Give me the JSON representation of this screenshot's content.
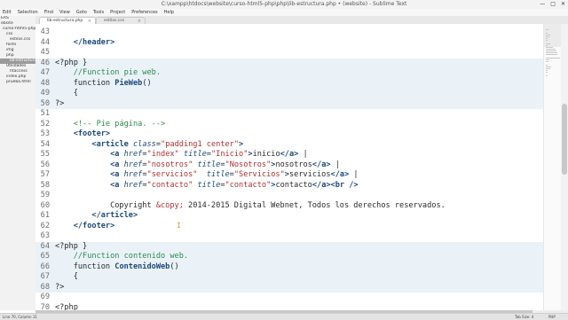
{
  "window": {
    "title": "C:\\xampp\\htdocs\\website\\curso-html5-php\\php\\lib-estructura.php • (website) - Sublime Text",
    "controls": [
      "—",
      "□",
      "✕"
    ]
  },
  "menu": [
    "Edit",
    "Selection",
    "Find",
    "View",
    "Goto",
    "Tools",
    "Project",
    "Preferences",
    "Help"
  ],
  "sidebar": {
    "items": [
      {
        "label": "ERS",
        "indent": 0
      },
      {
        "label": "ebsite",
        "indent": 0
      },
      {
        "label": "curso-html5-php",
        "indent": 2
      },
      {
        "label": "css",
        "indent": 6
      },
      {
        "label": "estilos.css",
        "indent": 10
      },
      {
        "label": "fonts",
        "indent": 6
      },
      {
        "label": "img",
        "indent": 6
      },
      {
        "label": "php",
        "indent": 6
      },
      {
        "label": "lib-estructura.php",
        "indent": 10,
        "selected": true
      },
      {
        "label": "Utilidades",
        "indent": 6
      },
      {
        "label": "htaccess",
        "indent": 10
      },
      {
        "label": "index.php",
        "indent": 6
      },
      {
        "label": "prueba.html",
        "indent": 6
      }
    ]
  },
  "tabs": [
    {
      "label": "lib-estructura.php",
      "active": true
    },
    {
      "label": "estilos.css",
      "active": false
    }
  ],
  "tab_close_glyph": "×",
  "editor": {
    "lines": [
      {
        "n": "43",
        "hl": false,
        "tokens": [
          [
            "",
            ""
          ]
        ]
      },
      {
        "n": "44",
        "hl": false,
        "tokens": [
          [
            "p",
            "    "
          ],
          [
            "t-tag",
            "</header>"
          ]
        ]
      },
      {
        "n": "45",
        "hl": false,
        "tokens": [
          [
            "",
            ""
          ]
        ]
      },
      {
        "n": "46",
        "hl": true,
        "tokens": [
          [
            "p",
            "<?php }"
          ]
        ]
      },
      {
        "n": "47",
        "hl": true,
        "tokens": [
          [
            "p",
            "    "
          ],
          [
            "t-cmt",
            "//Function pie web."
          ]
        ]
      },
      {
        "n": "48",
        "hl": true,
        "tokens": [
          [
            "p",
            "    function "
          ],
          [
            "t-fn",
            "PieWeb"
          ],
          [
            "p",
            "()"
          ]
        ]
      },
      {
        "n": "49",
        "hl": true,
        "tokens": [
          [
            "p",
            "    {"
          ]
        ]
      },
      {
        "n": "50",
        "hl": true,
        "tokens": [
          [
            "p",
            "?>"
          ]
        ]
      },
      {
        "n": "51",
        "hl": false,
        "tokens": [
          [
            "",
            ""
          ]
        ]
      },
      {
        "n": "52",
        "hl": false,
        "tokens": [
          [
            "p",
            "    "
          ],
          [
            "t-cmt",
            "<!-- Pie página. -->"
          ]
        ]
      },
      {
        "n": "53",
        "hl": false,
        "tokens": [
          [
            "p",
            "    "
          ],
          [
            "t-tag",
            "<footer>"
          ]
        ]
      },
      {
        "n": "54",
        "hl": false,
        "tokens": [
          [
            "p",
            "        "
          ],
          [
            "t-tag",
            "<article "
          ],
          [
            "t-attr",
            "class"
          ],
          [
            "p",
            "="
          ],
          [
            "t-str",
            "\"padding1 center\""
          ],
          [
            "t-tag",
            ">"
          ]
        ]
      },
      {
        "n": "55",
        "hl": false,
        "tokens": [
          [
            "p",
            "            "
          ],
          [
            "t-tag",
            "<a "
          ],
          [
            "t-attr",
            "href"
          ],
          [
            "p",
            "="
          ],
          [
            "t-str",
            "\"index\""
          ],
          [
            "p",
            " "
          ],
          [
            "t-attr",
            "title"
          ],
          [
            "p",
            "="
          ],
          [
            "t-str",
            "\"Inicio\""
          ],
          [
            "t-tag",
            ">"
          ],
          [
            "p",
            "inicio"
          ],
          [
            "t-tag",
            "</a>"
          ],
          [
            "p",
            " |"
          ]
        ]
      },
      {
        "n": "56",
        "hl": false,
        "tokens": [
          [
            "p",
            "            "
          ],
          [
            "t-tag",
            "<a "
          ],
          [
            "t-attr",
            "href"
          ],
          [
            "p",
            "="
          ],
          [
            "t-str",
            "\"nosotros\""
          ],
          [
            "p",
            " "
          ],
          [
            "t-attr",
            "title"
          ],
          [
            "p",
            "="
          ],
          [
            "t-str",
            "\"Nosotros\""
          ],
          [
            "t-tag",
            ">"
          ],
          [
            "p",
            "nosotros"
          ],
          [
            "t-tag",
            "</a>"
          ],
          [
            "p",
            " |"
          ]
        ]
      },
      {
        "n": "57",
        "hl": false,
        "tokens": [
          [
            "p",
            "            "
          ],
          [
            "t-tag",
            "<a "
          ],
          [
            "t-attr",
            "href"
          ],
          [
            "p",
            "="
          ],
          [
            "t-str",
            "\"servicios\""
          ],
          [
            "p",
            "  "
          ],
          [
            "t-attr",
            "title"
          ],
          [
            "p",
            "="
          ],
          [
            "t-str",
            "\"Servicios\""
          ],
          [
            "t-tag",
            ">"
          ],
          [
            "p",
            "servicios"
          ],
          [
            "t-tag",
            "</a>"
          ],
          [
            "p",
            " |"
          ]
        ]
      },
      {
        "n": "58",
        "hl": false,
        "tokens": [
          [
            "p",
            "            "
          ],
          [
            "t-tag",
            "<a "
          ],
          [
            "t-attr",
            "href"
          ],
          [
            "p",
            "="
          ],
          [
            "t-str",
            "\"contacto\""
          ],
          [
            "p",
            " "
          ],
          [
            "t-attr",
            "title"
          ],
          [
            "p",
            "="
          ],
          [
            "t-str",
            "\"contacto\""
          ],
          [
            "t-tag",
            ">"
          ],
          [
            "p",
            "contacto"
          ],
          [
            "t-tag",
            "</a><br />"
          ]
        ]
      },
      {
        "n": "59",
        "hl": false,
        "tokens": [
          [
            "",
            ""
          ]
        ]
      },
      {
        "n": "60",
        "hl": false,
        "tokens": [
          [
            "p",
            "            Copyright "
          ],
          [
            "t-ent",
            "&copy;"
          ],
          [
            "p",
            " 2014-2015 Digital Webnet, Todos los derechos reservados."
          ]
        ]
      },
      {
        "n": "61",
        "hl": false,
        "tokens": [
          [
            "p",
            "        "
          ],
          [
            "t-tag",
            "</article>"
          ]
        ]
      },
      {
        "n": "62",
        "hl": false,
        "tokens": [
          [
            "p",
            "    "
          ],
          [
            "t-tag",
            "</footer>"
          ]
        ]
      },
      {
        "n": "63",
        "hl": false,
        "tokens": [
          [
            "",
            ""
          ]
        ]
      },
      {
        "n": "64",
        "hl": true,
        "tokens": [
          [
            "p",
            "<?php }"
          ]
        ]
      },
      {
        "n": "65",
        "hl": true,
        "tokens": [
          [
            "p",
            "    "
          ],
          [
            "t-cmt",
            "//Function contenido web."
          ]
        ]
      },
      {
        "n": "66",
        "hl": true,
        "tokens": [
          [
            "p",
            "    function "
          ],
          [
            "t-fn",
            "ContenidoWeb"
          ],
          [
            "p",
            "()"
          ]
        ]
      },
      {
        "n": "67",
        "hl": true,
        "tokens": [
          [
            "p",
            "    {"
          ]
        ]
      },
      {
        "n": "68",
        "hl": true,
        "tokens": [
          [
            "p",
            "?>"
          ]
        ]
      },
      {
        "n": "69",
        "hl": false,
        "tokens": [
          [
            "",
            ""
          ]
        ]
      },
      {
        "n": "70",
        "hl": false,
        "tokens": [
          [
            "p",
            "<?php"
          ]
        ]
      }
    ]
  },
  "cursor_glyph": "I",
  "status": {
    "position": "Line 70, Column 11",
    "tab_size": "Tab Size: 4",
    "syntax": "PHP"
  },
  "colors": {
    "highlight": "#eaf2f8",
    "tag": "#1d4a7a",
    "string": "#b03030",
    "comment": "#2e8b4a"
  }
}
